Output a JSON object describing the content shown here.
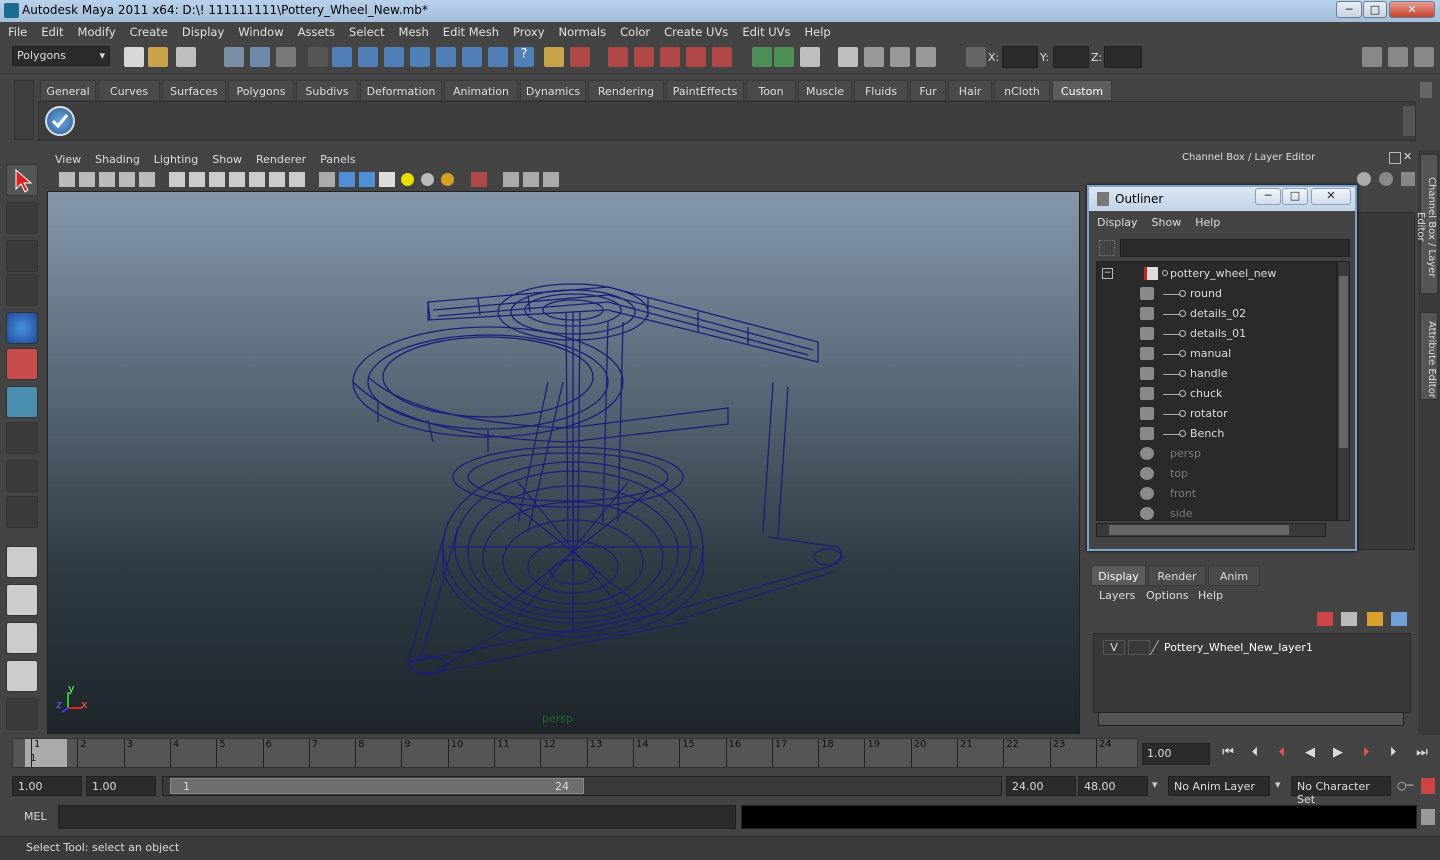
{
  "window": {
    "title": "Autodesk Maya 2011 x64: D:\\! 111111111\\Pottery_Wheel_New.mb*",
    "min": "─",
    "max": "□",
    "close": "✕"
  },
  "menubar": [
    "File",
    "Edit",
    "Modify",
    "Create",
    "Display",
    "Window",
    "Assets",
    "Select",
    "Mesh",
    "Edit Mesh",
    "Proxy",
    "Normals",
    "Color",
    "Create UVs",
    "Edit UVs",
    "Help"
  ],
  "statusline": {
    "mode": "Polygons",
    "x_label": "X:",
    "y_label": "Y:",
    "z_label": "Z:"
  },
  "shelf": {
    "tabs": [
      "General",
      "Curves",
      "Surfaces",
      "Polygons",
      "Subdivs",
      "Deformation",
      "Animation",
      "Dynamics",
      "Rendering",
      "PaintEffects",
      "Toon",
      "Muscle",
      "Fluids",
      "Fur",
      "Hair",
      "nCloth",
      "Custom"
    ],
    "active_tab": "Custom"
  },
  "viewport": {
    "menu": [
      "View",
      "Shading",
      "Lighting",
      "Show",
      "Renderer",
      "Panels"
    ],
    "camera_label": "persp",
    "axis": {
      "x": "x",
      "y": "y",
      "z": "z"
    }
  },
  "channel_box": {
    "title": "Channel Box / Layer Editor"
  },
  "side_tabs": {
    "channel": "Channel Box / Layer Editor",
    "attribute": "Attribute Editor"
  },
  "outliner": {
    "title": "Outliner",
    "menu": [
      "Display",
      "Show",
      "Help"
    ],
    "root": "pottery_wheel_new",
    "children": [
      "round",
      "details_02",
      "details_01",
      "manual",
      "handle",
      "chuck",
      "rotator",
      "Bench"
    ],
    "cameras": [
      "persp",
      "top",
      "front",
      "side"
    ]
  },
  "layer_editor": {
    "tabs": [
      "Display",
      "Render",
      "Anim"
    ],
    "active_tab": "Display",
    "menu": [
      "Layers",
      "Options",
      "Help"
    ],
    "layers": [
      {
        "visible": "V",
        "name": "Pottery_Wheel_New_layer1"
      }
    ]
  },
  "time_slider": {
    "frames": [
      "1",
      "2",
      "3",
      "4",
      "5",
      "6",
      "7",
      "8",
      "9",
      "10",
      "11",
      "12",
      "13",
      "14",
      "15",
      "16",
      "17",
      "18",
      "19",
      "20",
      "21",
      "22",
      "23",
      "24"
    ],
    "current_frame": "1",
    "current_time": "1.00"
  },
  "range_slider": {
    "start_time": "1.00",
    "playback_start": "1.00",
    "range_start": "1",
    "range_end": "24",
    "playback_end": "24.00",
    "end_time": "48.00",
    "anim_layer": "No Anim Layer",
    "character_set": "No Character Set"
  },
  "command_line": {
    "label": "MEL"
  },
  "help_line": "Select Tool: select an object",
  "colors": {
    "wireframe": "#1d1e7a",
    "ui_bg": "#444444",
    "title_bar": "#b9d1ea",
    "outliner_border": "#7aa4cc"
  }
}
